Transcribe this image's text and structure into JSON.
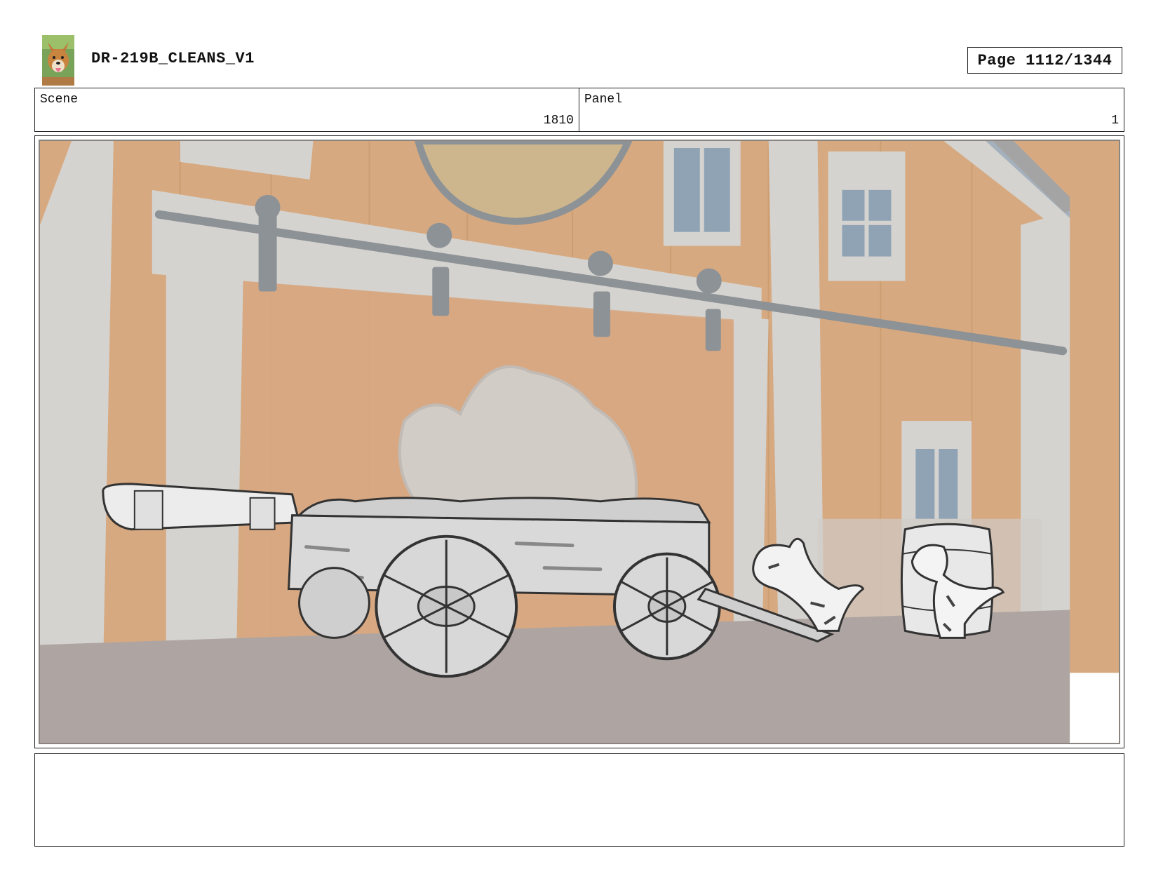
{
  "header": {
    "title": "DR-219B_CLEANS_V1",
    "page_label": "Page 1112/1344"
  },
  "info": {
    "scene_label": "Scene",
    "scene_value": "1810",
    "panel_label": "Panel",
    "panel_value": "1"
  },
  "notes": {
    "text": ""
  },
  "colors": {
    "wall": "#d6a980",
    "trim": "#d5d3cf",
    "ground": "#aea5a2",
    "window_glass": "#8fa3b5",
    "rail": "#8d9296"
  }
}
